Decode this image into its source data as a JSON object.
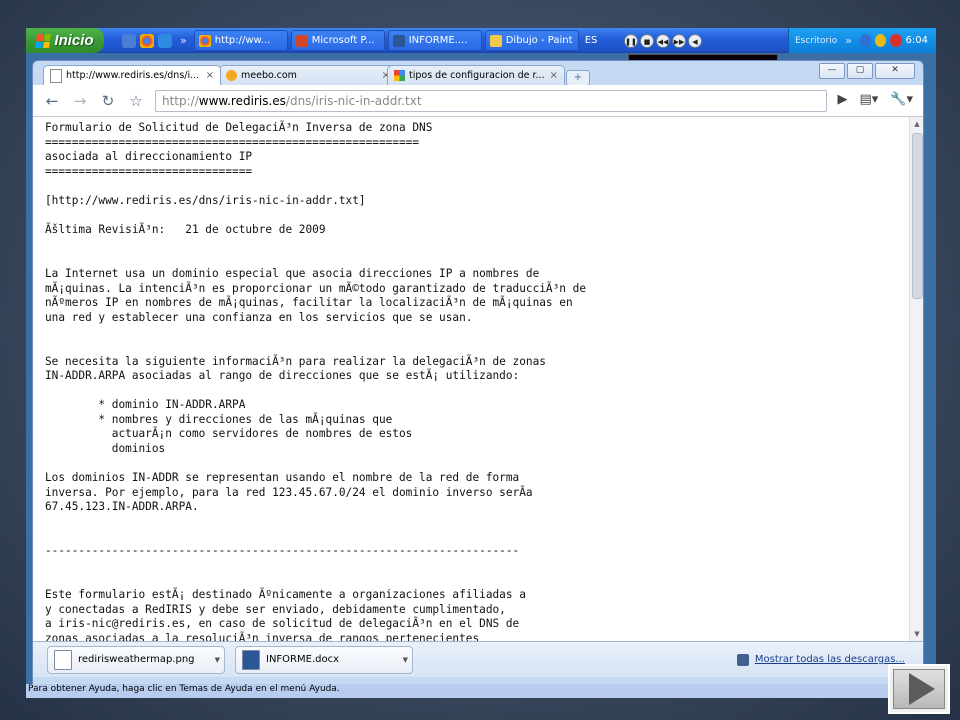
{
  "taskbar": {
    "start_label": "Inicio",
    "tasks": [
      {
        "label": "http://ww...",
        "icon": "chrome-icon",
        "color": "#e8b52a"
      },
      {
        "label": "Microsoft P...",
        "icon": "powerpoint-icon",
        "color": "#d24625"
      },
      {
        "label": "INFORME....",
        "icon": "word-icon",
        "color": "#2b5797"
      },
      {
        "label": "Dibujo - Paint",
        "icon": "paint-icon",
        "color": "#f2c84b"
      }
    ],
    "lang": "ES",
    "desktop_label": "Escritorio",
    "clock": "6:04"
  },
  "browser": {
    "tabs": [
      {
        "label": "http://www.rediris.es/dns/i...",
        "icon": "page-icon"
      },
      {
        "label": "meebo.com",
        "icon": "meebo-icon"
      },
      {
        "label": "tipos de configuracion de r...",
        "icon": "google-icon"
      }
    ],
    "url_scheme": "http://",
    "url_host": "www.rediris.es",
    "url_path": "/dns/iris-nic-in-addr.txt",
    "page_text": "Formulario de Solicitud de DelegaciÃ³n Inversa de zona DNS\n========================================================\nasociada al direccionamiento IP\n===============================\n\n[http://www.rediris.es/dns/iris-nic-in-addr.txt]\n\nÃšltima RevisiÃ³n:   21 de octubre de 2009\n\n\nLa Internet usa un dominio especial que asocia direcciones IP a nombres de\nmÃ¡quinas. La intenciÃ³n es proporcionar un mÃ©todo garantizado de traducciÃ³n de\nnÃºmeros IP en nombres de mÃ¡quinas, facilitar la localizaciÃ³n de mÃ¡quinas en\nuna red y establecer una confianza en los servicios que se usan.\n\n\nSe necesita la siguiente informaciÃ³n para realizar la delegaciÃ³n de zonas\nIN-ADDR.ARPA asociadas al rango de direcciones que se estÃ¡ utilizando:\n\n        * dominio IN-ADDR.ARPA\n        * nombres y direcciones de las mÃ¡quinas que\n          actuarÃ¡n como servidores de nombres de estos\n          dominios\n\nLos dominios IN-ADDR se representan usando el nombre de la red de forma\ninversa. Por ejemplo, para la red 123.45.67.0/24 el dominio inverso serÃ­a\n67.45.123.IN-ADDR.ARPA.\n\n\n-----------------------------------------------------------------------\n\n\nEste formulario estÃ¡ destinado Ãºnicamente a organizaciones afiliadas a\ny conectadas a RedIRIS y debe ser enviado, debidamente cumplimentado,\na iris-nic@rediris.es, en caso de solicitud de delegaciÃ³n en el DNS de\nzonas asociadas a la resoluciÃ³n inversa de rangos pertenecientes\na las prefijos"
  },
  "downloads": {
    "items": [
      {
        "label": "redirisweathermap.png"
      },
      {
        "label": "INFORME.docx"
      }
    ],
    "show_all": "Mostrar todas las descargas..."
  },
  "status_text": "Para obtener Ayuda, haga clic en Temas de Ayuda en el menú Ayuda."
}
